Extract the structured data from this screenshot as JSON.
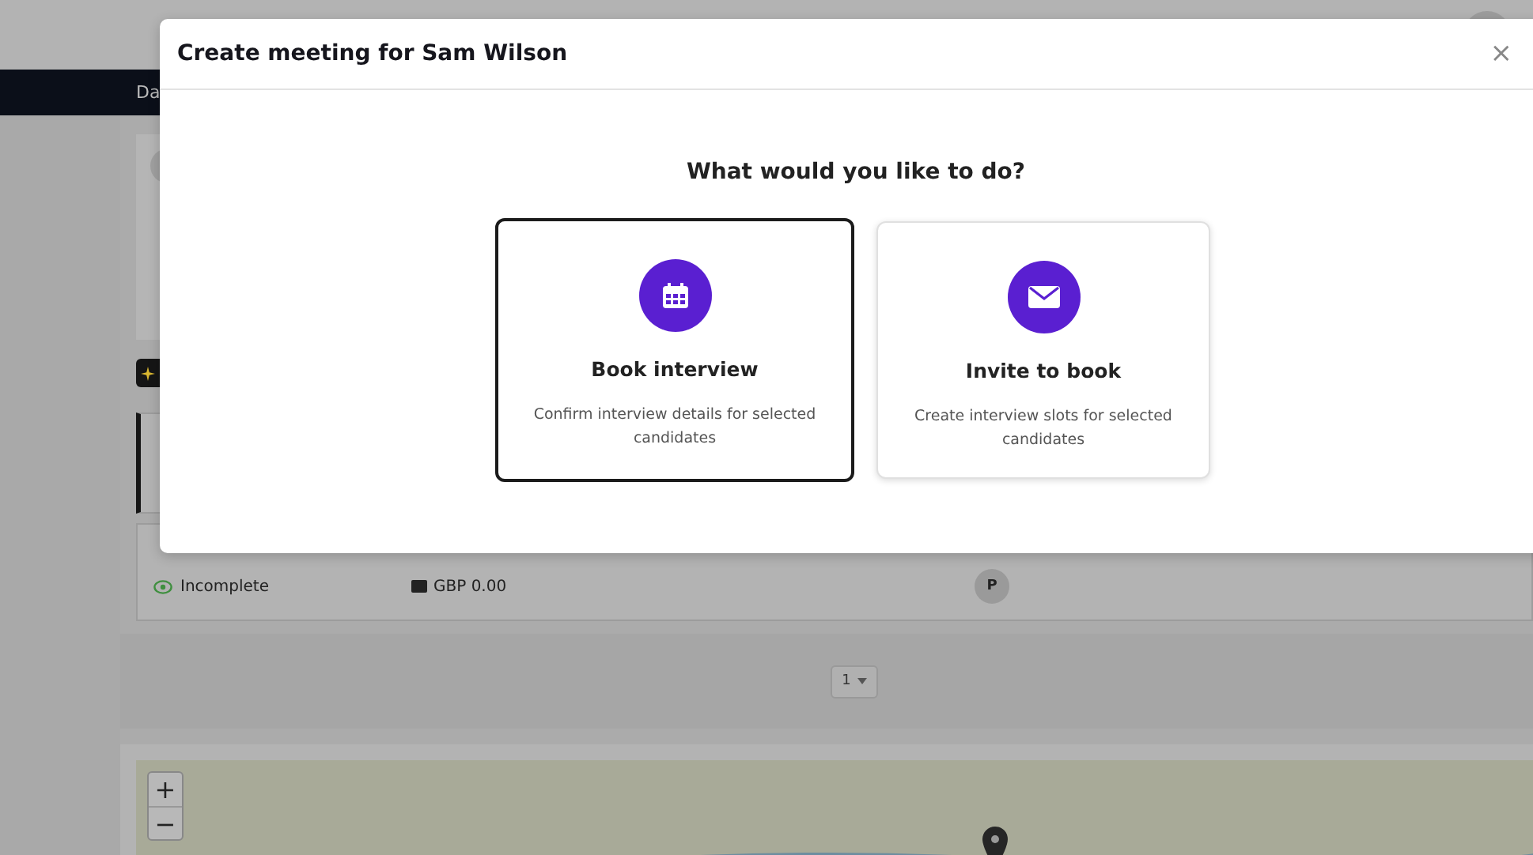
{
  "nav": {
    "items": [
      {
        "label": "Da"
      }
    ]
  },
  "candidates": [
    {
      "selected": true
    },
    {
      "selected": false,
      "status": "Incomplete",
      "amount": "GBP 0.00",
      "initial": "P"
    }
  ],
  "pager": {
    "value": "1"
  },
  "map": {
    "zoom_in": "+",
    "zoom_out": "−"
  },
  "modal": {
    "title": "Create meeting for Sam Wilson",
    "close": "×",
    "question": "What would you like to do?",
    "options": [
      {
        "kind": "calendar",
        "title": "Book interview",
        "description": "Confirm interview details for selected candidates",
        "selected": true
      },
      {
        "kind": "mail",
        "title": "Invite to book",
        "description": "Create interview slots for selected candidates",
        "selected": false
      }
    ]
  }
}
